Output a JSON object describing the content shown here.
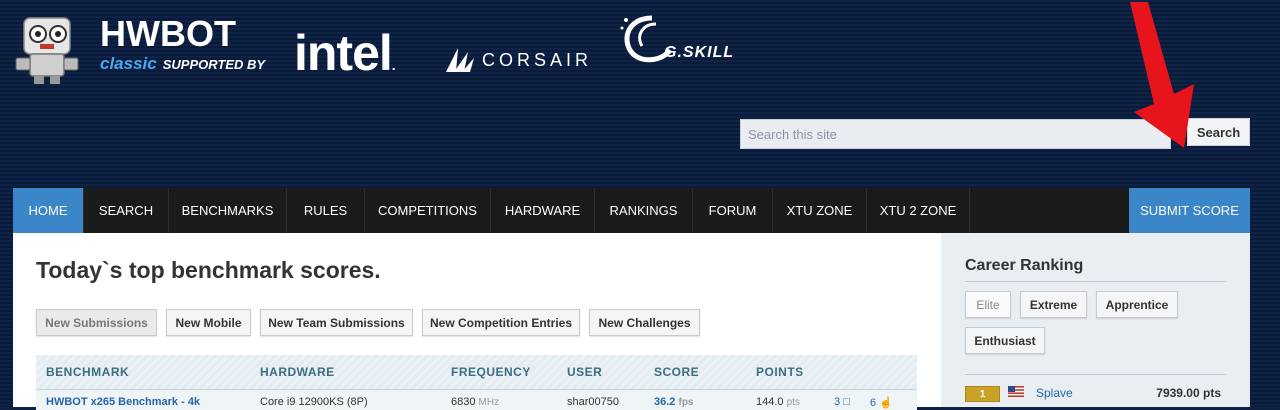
{
  "brand": {
    "title": "HWBOT",
    "classic": "classic",
    "supported_by": "SUPPORTED BY",
    "sponsors": {
      "intel": "intel",
      "intel_dot": ".",
      "corsair": "CORSAIR",
      "gskill": "G.SKILL"
    }
  },
  "search": {
    "placeholder": "Search this site",
    "button": "Search"
  },
  "nav": {
    "items": [
      "HOME",
      "SEARCH",
      "BENCHMARKS",
      "RULES",
      "COMPETITIONS",
      "HARDWARE",
      "RANKINGS",
      "FORUM",
      "XTU ZONE",
      "XTU 2 ZONE"
    ],
    "active": "HOME",
    "submit": "SUBMIT SCORE"
  },
  "main": {
    "title": "Today`s top benchmark scores.",
    "filters": [
      "New Submissions",
      "New Mobile",
      "New Team Submissions",
      "New Competition Entries",
      "New Challenges"
    ],
    "active_filter": "New Submissions",
    "columns": [
      "BENCHMARK",
      "HARDWARE",
      "FREQUENCY",
      "USER",
      "SCORE",
      "POINTS"
    ],
    "rows": [
      {
        "benchmark": "HWBOT x265 Benchmark - 4k",
        "hardware": "Core i9 12900KS (8P)",
        "frequency": "6830",
        "frequency_unit": "MHz",
        "user": "shar00750",
        "score": "36.2",
        "score_unit": "fps",
        "points": "144.0",
        "points_unit": "pts",
        "comments": "3",
        "likes": "6"
      }
    ]
  },
  "sidebar": {
    "title": "Career Ranking",
    "buttons": [
      "Elite",
      "Extreme",
      "Apprentice",
      "Enthusiast"
    ],
    "active_button": "Elite",
    "ranking": [
      {
        "rank": "1",
        "user": "Splave",
        "points": "7939.00 pts",
        "rank_color": "#c9a227"
      }
    ]
  },
  "colors": {
    "accent": "#3a86c8",
    "nav_bg": "#1b1b1b",
    "header_bg": "#0e2347",
    "link": "#2566a8",
    "arrow": "#e8141b"
  }
}
